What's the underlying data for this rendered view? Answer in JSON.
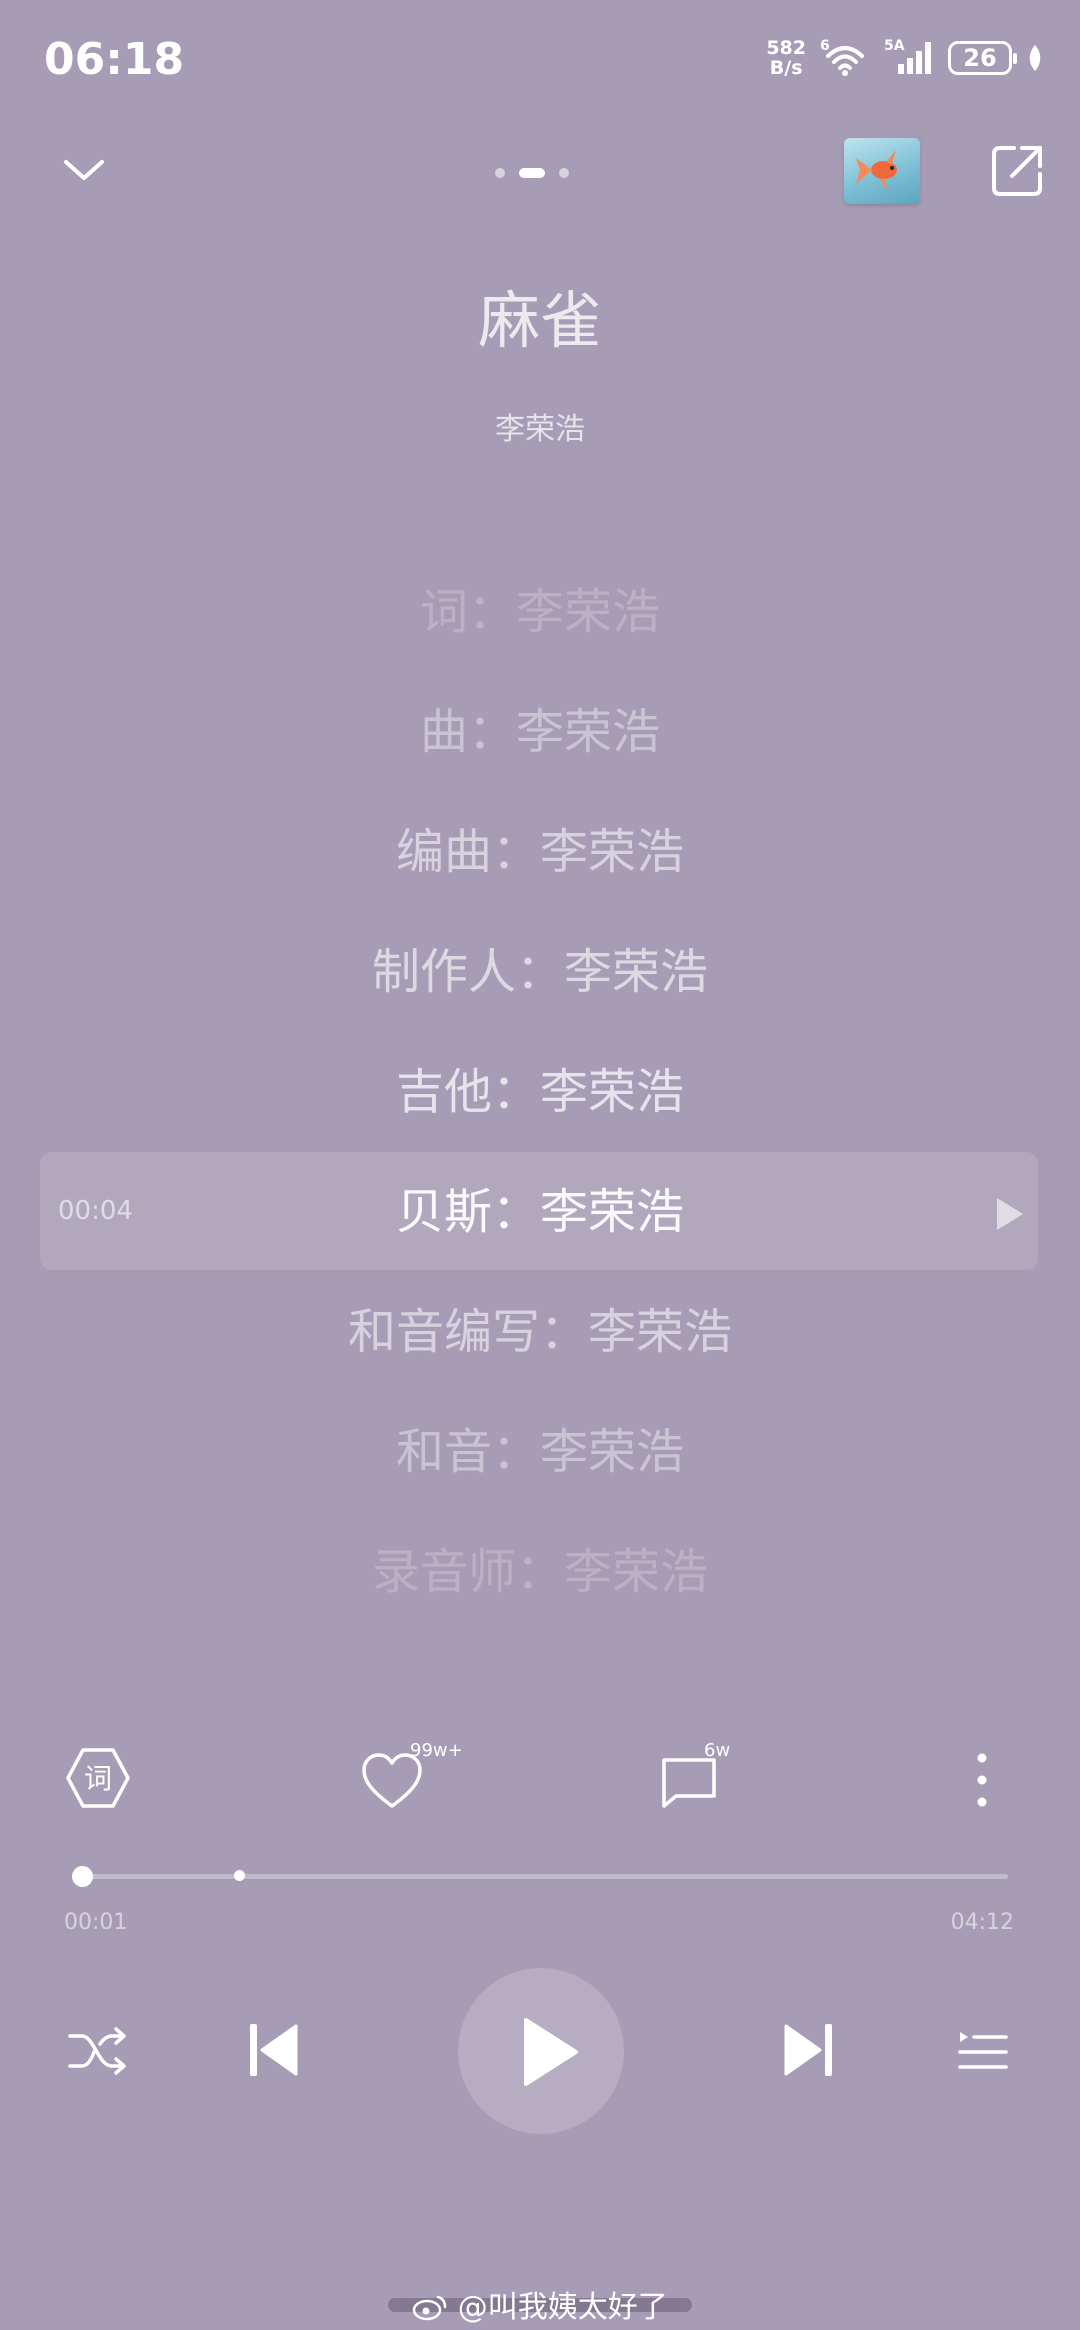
{
  "status": {
    "time": "06:18",
    "net_speed_value": "582",
    "net_speed_unit": "B/s",
    "wifi_label": "6",
    "signal_label": "5A",
    "battery": "26"
  },
  "player": {
    "page_dots": 3,
    "active_dot": 1,
    "title": "麻雀",
    "artist": "李荣浩"
  },
  "lyrics": [
    {
      "text": "词：李荣浩",
      "opacity": 0.22
    },
    {
      "text": "曲：李荣浩",
      "opacity": 0.4
    },
    {
      "text": "编曲：李荣浩",
      "opacity": 0.55
    },
    {
      "text": "制作人：李荣浩",
      "opacity": 0.62
    },
    {
      "text": "吉他：李荣浩",
      "opacity": 0.72
    },
    {
      "text": "贝斯：李荣浩",
      "opacity": 0.92
    },
    {
      "text": "和音编写：李荣浩",
      "opacity": 0.55
    },
    {
      "text": "和音：李荣浩",
      "opacity": 0.4
    },
    {
      "text": "录音师：李荣浩",
      "opacity": 0.22
    }
  ],
  "lyric_current_time": "00:04",
  "actions": {
    "like_count": "99w+",
    "comment_count": "6w",
    "lyric_icon_label": "词"
  },
  "progress": {
    "elapsed": "00:01",
    "total": "04:12",
    "played_fraction": 0.004,
    "buffered_fraction": 0.173
  },
  "watermark": "@叫我姨太好了"
}
